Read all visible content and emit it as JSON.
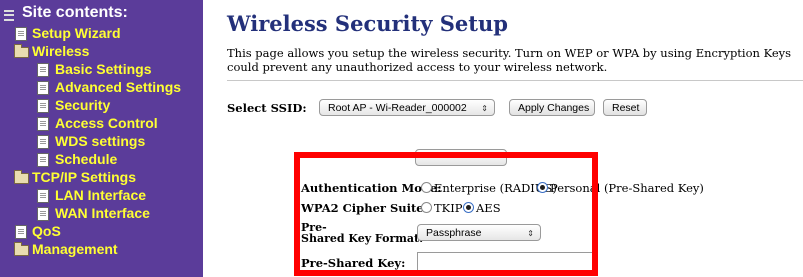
{
  "sidebar": {
    "title": "Site contents:",
    "items": [
      {
        "label": "Setup Wizard",
        "icon": "document-icon"
      },
      {
        "label": "Wireless",
        "icon": "folder-icon"
      },
      {
        "label": "Basic Settings",
        "icon": "document-icon"
      },
      {
        "label": "Advanced Settings",
        "icon": "document-icon"
      },
      {
        "label": "Security",
        "icon": "document-icon"
      },
      {
        "label": "Access Control",
        "icon": "document-icon"
      },
      {
        "label": "WDS settings",
        "icon": "document-icon"
      },
      {
        "label": "Schedule",
        "icon": "document-icon"
      },
      {
        "label": "TCP/IP Settings",
        "icon": "folder-icon"
      },
      {
        "label": "LAN Interface",
        "icon": "document-icon"
      },
      {
        "label": "WAN Interface",
        "icon": "document-icon"
      },
      {
        "label": "QoS",
        "icon": "document-icon"
      },
      {
        "label": "Management",
        "icon": "folder-icon"
      }
    ]
  },
  "main": {
    "title": "Wireless Security Setup",
    "intro": "This page allows you setup the wireless security. Turn on WEP or WPA by using Encryption Keys could prevent any unauthorized access to your wireless network.",
    "ssid": {
      "label": "Select SSID:",
      "selected": "Root AP - Wi-Reader_000002",
      "apply_label": "Apply Changes",
      "reset_label": "Reset"
    },
    "form": {
      "auth_mode": {
        "label": "Authentication Mode:",
        "options": [
          "Enterprise (RADIUS)",
          "Personal (Pre-Shared Key)"
        ],
        "selected": "Personal (Pre-Shared Key)"
      },
      "cipher": {
        "label": "WPA2 Cipher Suite:",
        "options": [
          "TKIP",
          "AES"
        ],
        "selected": "AES"
      },
      "psk_format": {
        "label_line1": "Pre-",
        "label_line2": "Shared Key Format:",
        "selected": "Passphrase"
      },
      "psk": {
        "label": "Pre-Shared Key:",
        "value": ""
      }
    }
  },
  "colors": {
    "sidebar_bg": "#5b3c9a",
    "sidebar_text": "#ffff33",
    "title": "#23307a",
    "highlight": "#ff0000"
  }
}
